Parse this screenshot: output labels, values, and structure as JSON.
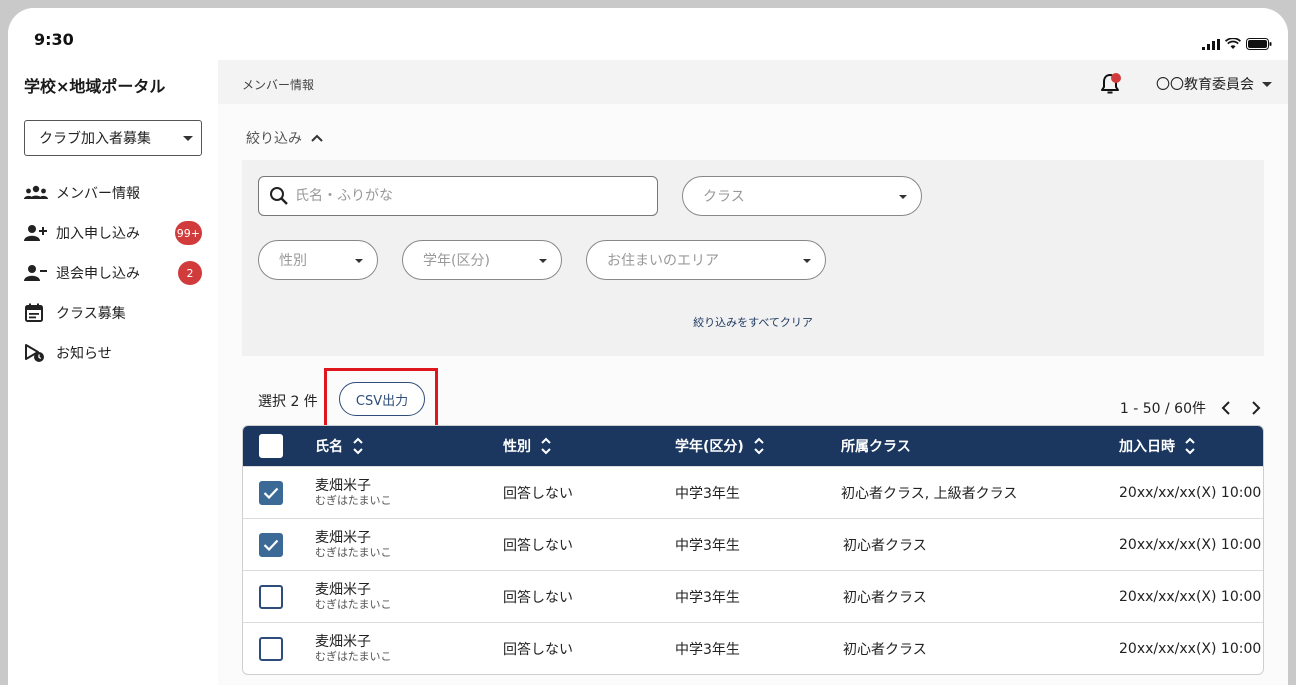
{
  "status_bar": {
    "time": "9:30"
  },
  "sidebar": {
    "app_title": "学校×地域ポータル",
    "club_select": "クラブ加入者募集",
    "items": [
      {
        "label": "メンバー情報",
        "icon": "members-icon"
      },
      {
        "label": "加入申し込み",
        "icon": "user-add-icon",
        "badge": "99+"
      },
      {
        "label": "退会申し込み",
        "icon": "user-remove-icon",
        "badge": "2"
      },
      {
        "label": "クラス募集",
        "icon": "calendar-icon"
      },
      {
        "label": "お知らせ",
        "icon": "notice-icon"
      }
    ]
  },
  "header": {
    "breadcrumb": "メンバー情報",
    "org_name": "〇〇教育委員会"
  },
  "filters": {
    "toggle_label": "絞り込み",
    "search_placeholder": "氏名・ふりがな",
    "class_placeholder": "クラス",
    "gender_placeholder": "性別",
    "grade_placeholder": "学年(区分)",
    "area_placeholder": "お住まいのエリア",
    "clear_label": "絞り込みをすべてクリア"
  },
  "toolbar": {
    "selected_count": "選択 2 件",
    "csv_label": "CSV出力",
    "pagination": "1 - 50 / 60件"
  },
  "table": {
    "headers": {
      "name": "氏名",
      "gender": "性別",
      "grade": "学年(区分)",
      "class": "所属クラス",
      "joined": "加入日時"
    },
    "rows": [
      {
        "checked": true,
        "name": "麦畑米子",
        "kana": "むぎはたまいこ",
        "gender": "回答しない",
        "grade": "中学3年生",
        "class": "初心者クラス, 上級者クラス",
        "joined": "20xx/xx/xx(X) 10:00"
      },
      {
        "checked": true,
        "name": "麦畑米子",
        "kana": "むぎはたまいこ",
        "gender": "回答しない",
        "grade": "中学3年生",
        "class": "初心者クラス",
        "joined": "20xx/xx/xx(X) 10:00"
      },
      {
        "checked": false,
        "name": "麦畑米子",
        "kana": "むぎはたまいこ",
        "gender": "回答しない",
        "grade": "中学3年生",
        "class": "初心者クラス",
        "joined": "20xx/xx/xx(X) 10:00"
      },
      {
        "checked": false,
        "name": "麦畑米子",
        "kana": "むぎはたまいこ",
        "gender": "回答しない",
        "grade": "中学3年生",
        "class": "初心者クラス",
        "joined": "20xx/xx/xx(X) 10:00"
      }
    ]
  },
  "colors": {
    "header_navy": "#1b375f",
    "accent_blue": "#3b6a96",
    "badge_red": "#d13b3b",
    "highlight_red": "#e0161e"
  }
}
